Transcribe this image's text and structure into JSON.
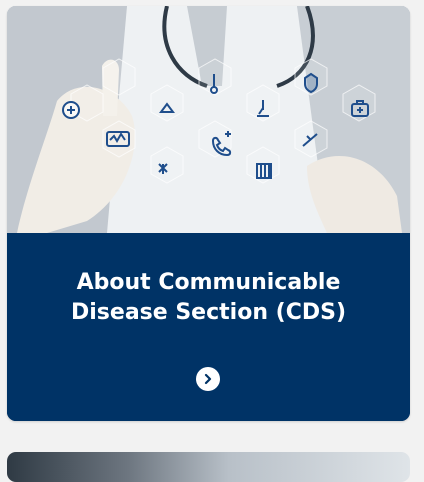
{
  "card": {
    "title_line1": "About Communicable",
    "title_line2": "Disease Section (CDS)",
    "image_icon": "medical-icons-hexagon-network",
    "arrow_icon": "chevron-right-icon",
    "colors": {
      "card_background": "#003366",
      "title_text": "#ffffff",
      "page_background": "#f2f2f2"
    }
  }
}
